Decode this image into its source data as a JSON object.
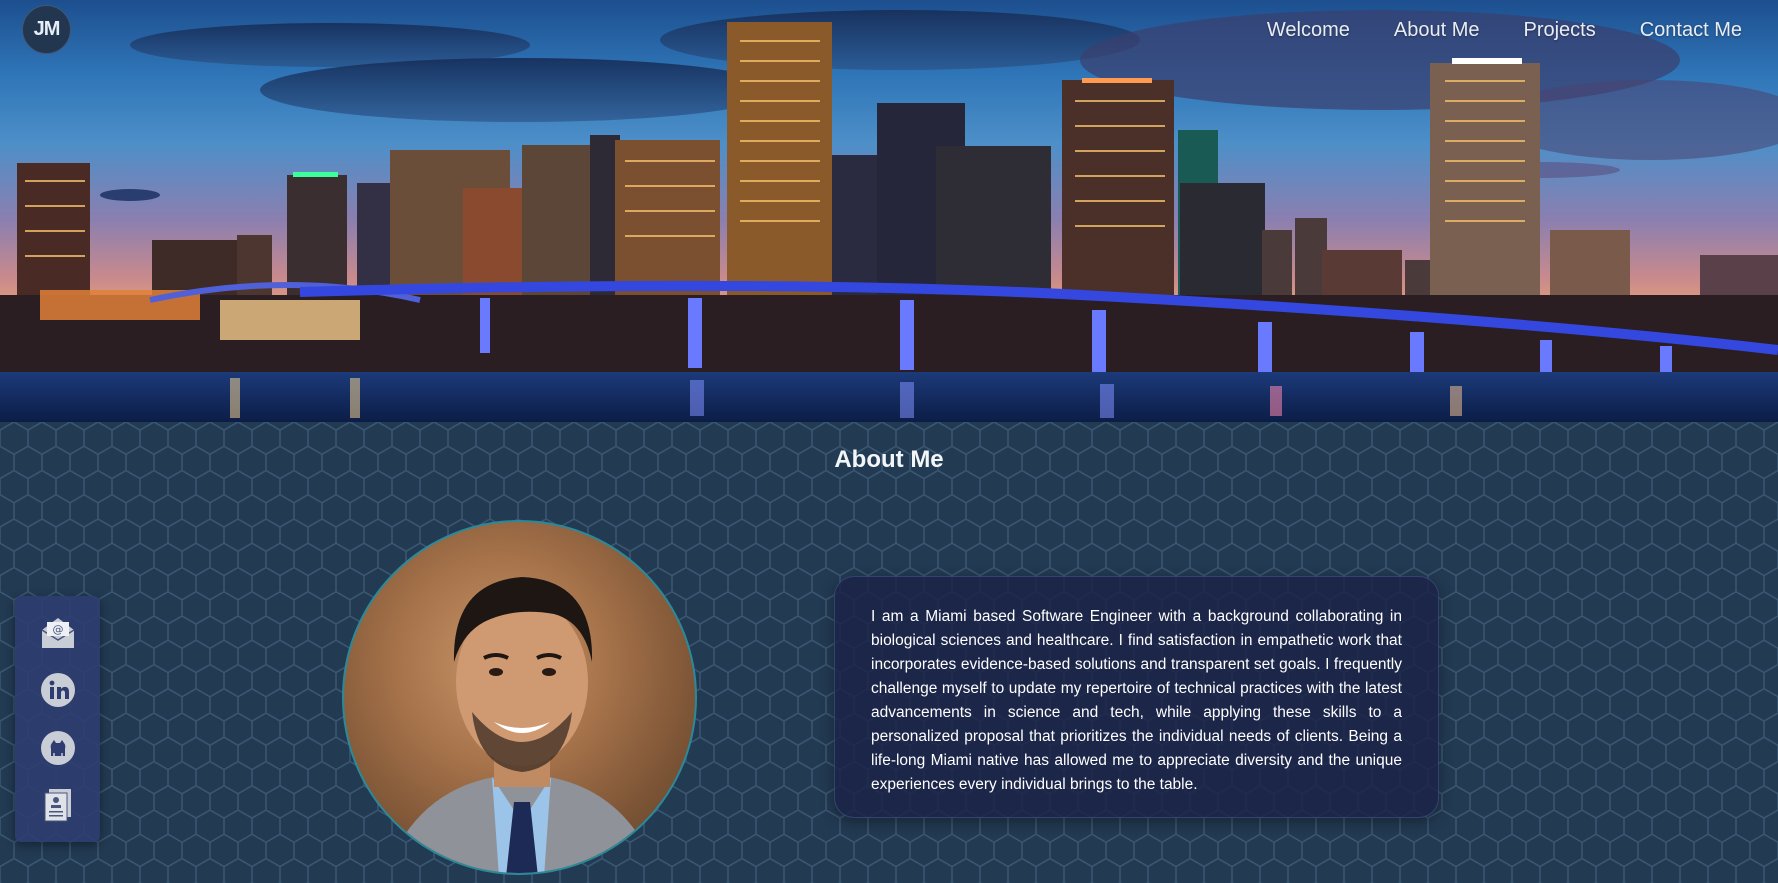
{
  "header": {
    "logo_text": "JM",
    "nav": [
      {
        "label": "Welcome"
      },
      {
        "label": "About Me"
      },
      {
        "label": "Projects"
      },
      {
        "label": "Contact Me"
      }
    ]
  },
  "about": {
    "title": "About Me",
    "bio": "I am a Miami based Software Engineer with a background collaborating in biological sciences and healthcare. I find satisfaction in empathetic work that incorporates evidence-based solutions and transparent set goals. I frequently challenge myself to update my repertoire of technical practices with the latest advancements in science and tech, while applying these skills to a personalized proposal that prioritizes the individual needs of clients. Being a life-long Miami native has allowed me to appreciate diversity and the unique experiences every individual brings to the table."
  },
  "social": [
    {
      "icon": "email-icon"
    },
    {
      "icon": "linkedin-icon"
    },
    {
      "icon": "github-icon"
    },
    {
      "icon": "resume-icon"
    }
  ],
  "colors": {
    "section_bg": "#223a52",
    "card_bg": "#1b2246",
    "sidebar_bg": "#2e3c70",
    "portrait_ring": "#2b8a9a",
    "text": "#ffffff"
  }
}
